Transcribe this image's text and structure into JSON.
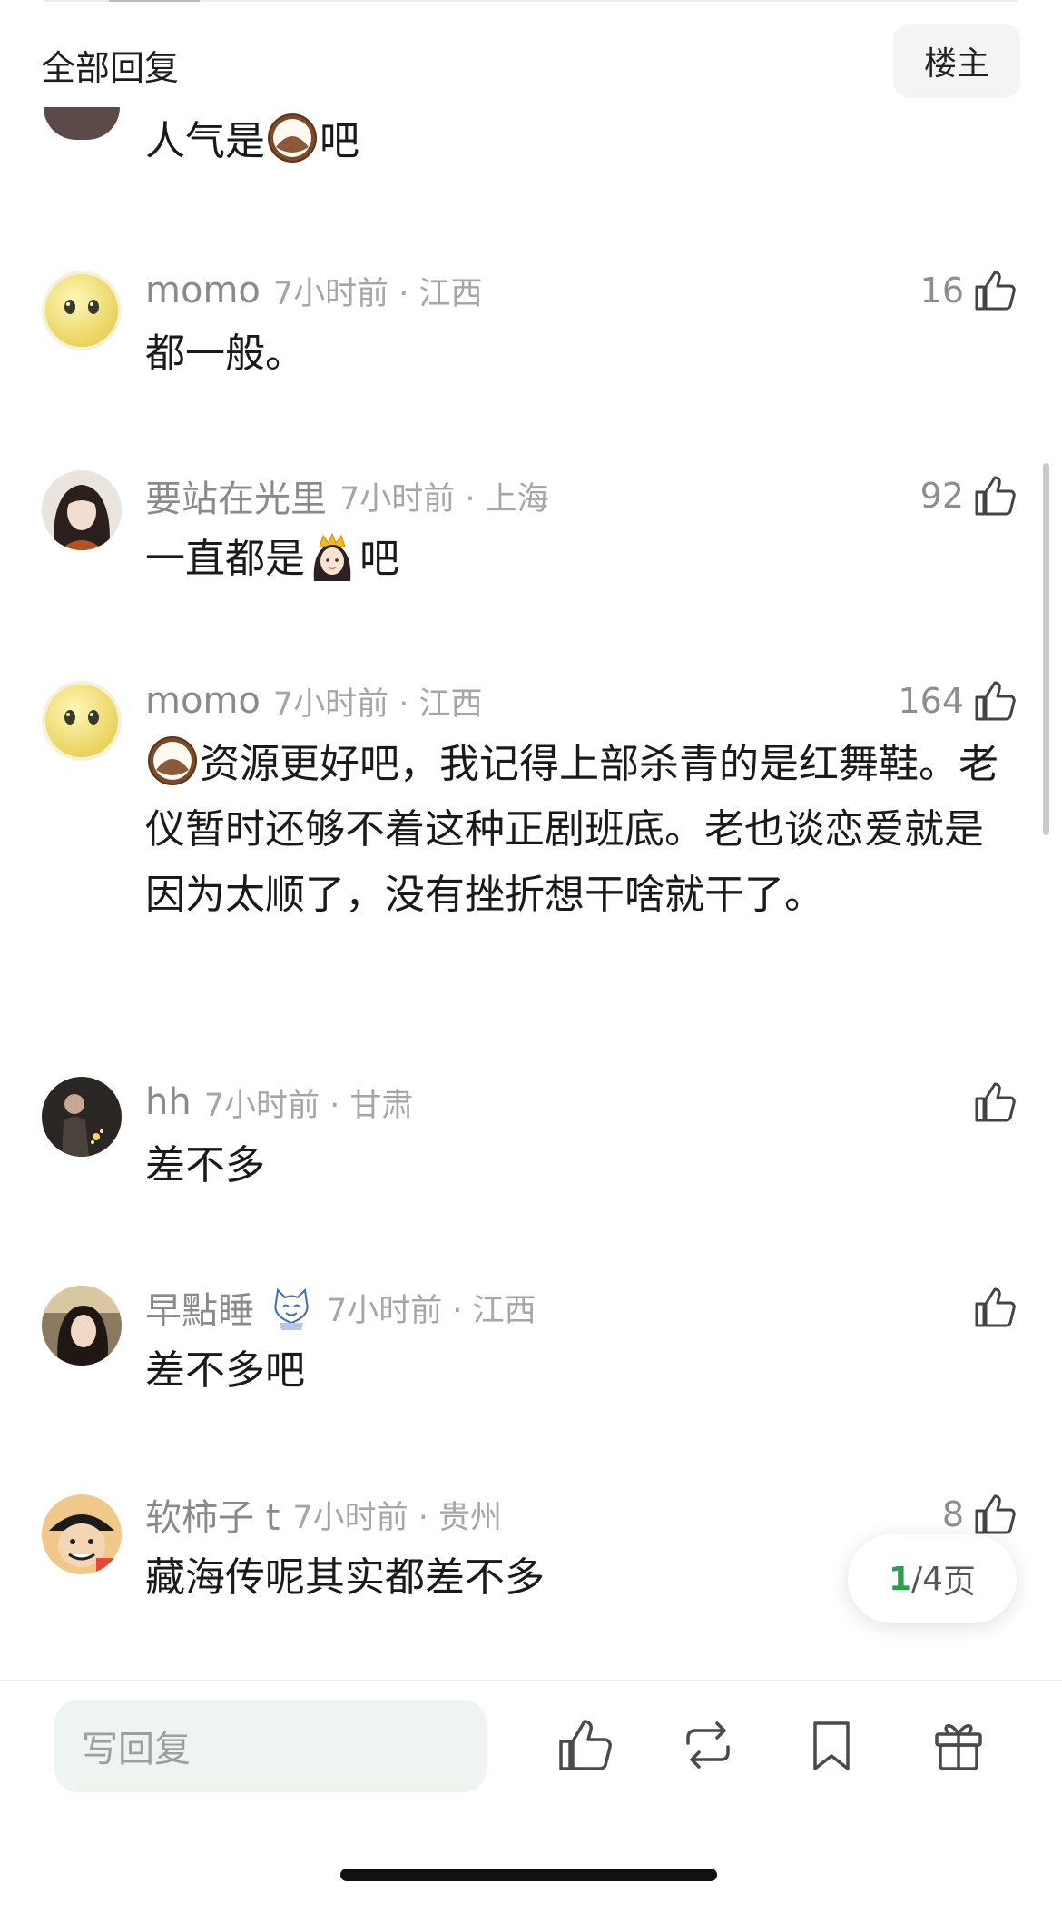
{
  "header": {
    "title": "全部回复",
    "op_button": "楼主"
  },
  "comments": [
    {
      "text_a": "人气是",
      "emoji": "coconut-emoji",
      "text_b": "吧"
    },
    {
      "username": "momo",
      "time_loc": "7小时前 · 江西",
      "likes": "16",
      "text": "都一般。"
    },
    {
      "username": "要站在光里",
      "time_loc": "7小时前 · 上海",
      "likes": "92",
      "text_a": "一直都是",
      "emoji": "princess-emoji",
      "text_b": "吧"
    },
    {
      "username": "momo",
      "time_loc": "7小时前 · 江西",
      "likes": "164",
      "emoji": "coconut-emoji",
      "text": "资源更好吧，我记得上部杀青的是红舞鞋。老仪暂时还够不着这种正剧班底。老也谈恋爱就是因为太顺了，没有挫折想干啥就干了。"
    },
    {
      "username": "hh",
      "time_loc": "7小时前 · 甘肃",
      "likes": "",
      "text": "差不多"
    },
    {
      "username": "早點睡",
      "time_loc": "7小时前 · 江西",
      "likes": "",
      "badge": "cat-badge-icon",
      "text": "差不多吧"
    },
    {
      "username": "软柿子 t",
      "time_loc": "7小时前 · 贵州",
      "likes": "8",
      "text": "藏海传呢其实都差不多"
    }
  ],
  "pagination": {
    "current": "1",
    "separator": "/",
    "total": "4",
    "unit": " 页"
  },
  "bottom_bar": {
    "reply_placeholder": "写回复",
    "icons": [
      "thumbs-up-icon",
      "repost-icon",
      "bookmark-icon",
      "gift-icon"
    ]
  },
  "colors": {
    "accent_green": "#2aa04a",
    "input_bg": "#eef4ef",
    "meta_gray": "#a6a6a6"
  }
}
